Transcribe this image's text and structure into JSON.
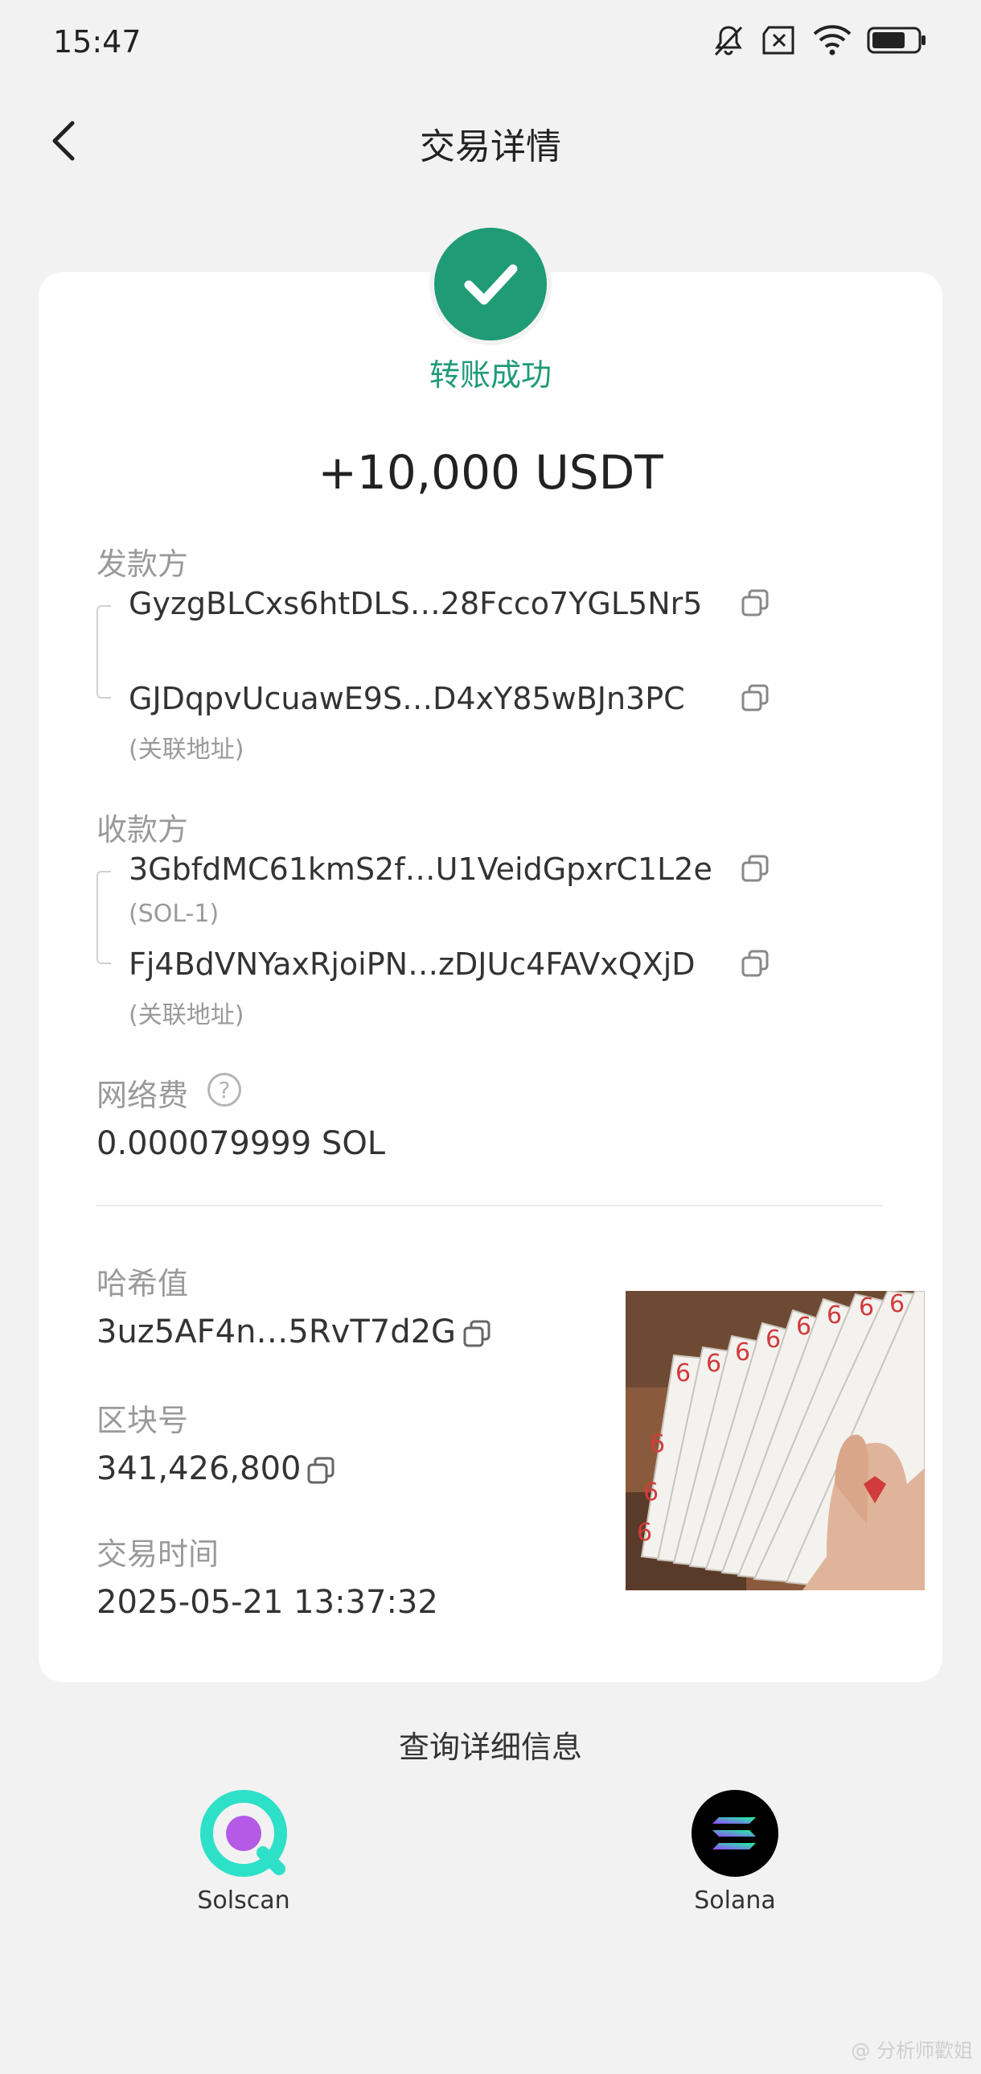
{
  "status_bar": {
    "time": "15:47",
    "icons": [
      "bell-muted-icon",
      "sim-x-icon",
      "wifi-icon",
      "battery-icon"
    ]
  },
  "header": {
    "title": "交易详情",
    "back_icon": "chevron-left-icon"
  },
  "transaction": {
    "status_text": "转账成功",
    "status_color": "#1f9b76",
    "amount": "+10,000 USDT",
    "sender": {
      "label": "发款方",
      "address_1": "GyzgBLCxs6htDLS…28Fcco7YGL5Nr5",
      "address_2": "GJDqpvUcuawE9S…D4xY85wBJn3PC",
      "address_2_note": "(关联地址)"
    },
    "receiver": {
      "label": "收款方",
      "address_1": "3GbfdMC61kmS2f…U1VeidGpxrC1L2e",
      "address_1_note": "(SOL-1)",
      "address_2": "Fj4BdVNYaxRjoiPN…zDJUc4FAVxQXjD",
      "address_2_note": "(关联地址)"
    },
    "fee": {
      "label": "网络费",
      "help": "?",
      "value": "0.000079999 SOL"
    },
    "hash": {
      "label": "哈希值",
      "value": "3uz5AF4n…5RvT7d2G"
    },
    "block": {
      "label": "区块号",
      "value": "341,426,800"
    },
    "time": {
      "label": "交易时间",
      "value": "2025-05-21 13:37:32"
    }
  },
  "query": {
    "title": "查询详细信息",
    "explorers": [
      {
        "label": "Solscan",
        "icon": "solscan-logo-icon",
        "color": "#2fe0c8"
      },
      {
        "label": "Solana",
        "icon": "solana-logo-icon",
        "color": "#000000"
      }
    ]
  },
  "watermark": "@ 分析师歡姐"
}
